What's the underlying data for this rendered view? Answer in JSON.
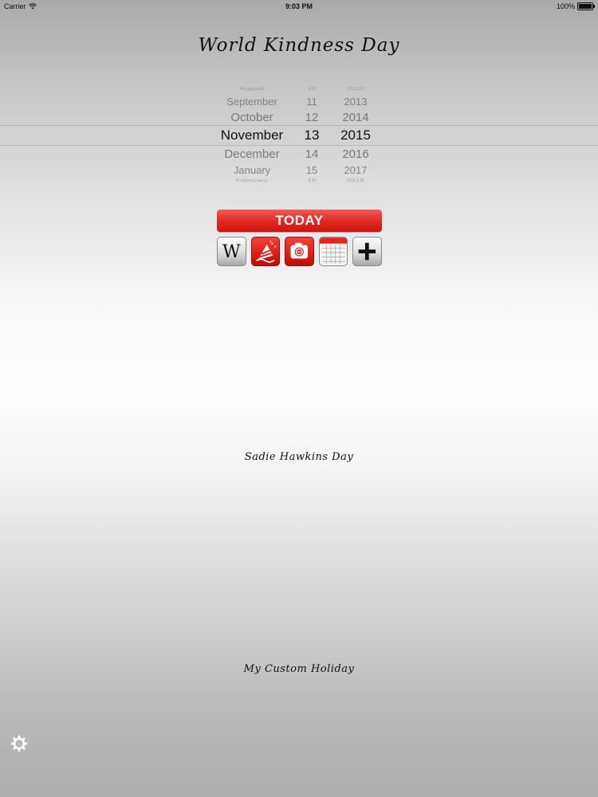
{
  "status_bar": {
    "carrier": "Carrier",
    "time": "9:03 PM",
    "battery": "100%"
  },
  "title": "World Kindness Day",
  "date_picker": {
    "months": [
      "August",
      "September",
      "October",
      "November",
      "December",
      "January",
      "February"
    ],
    "days": [
      "10",
      "11",
      "12",
      "13",
      "14",
      "15",
      "16"
    ],
    "years": [
      "2012",
      "2013",
      "2014",
      "2015",
      "2016",
      "2017",
      "2018"
    ],
    "selected": {
      "month": "November",
      "day": "13",
      "year": "2015"
    }
  },
  "today_button": {
    "label": "TODAY",
    "color": "#e32a24"
  },
  "toolbar_icons": [
    {
      "name": "wikipedia-icon",
      "letter": "W"
    },
    {
      "name": "party-icon"
    },
    {
      "name": "camera-icon"
    },
    {
      "name": "calendar-icon"
    },
    {
      "name": "add-icon"
    }
  ],
  "holidays": [
    "Sadie Hawkins Day",
    "My Custom Holiday"
  ],
  "settings": {
    "icon": "gear-icon"
  }
}
